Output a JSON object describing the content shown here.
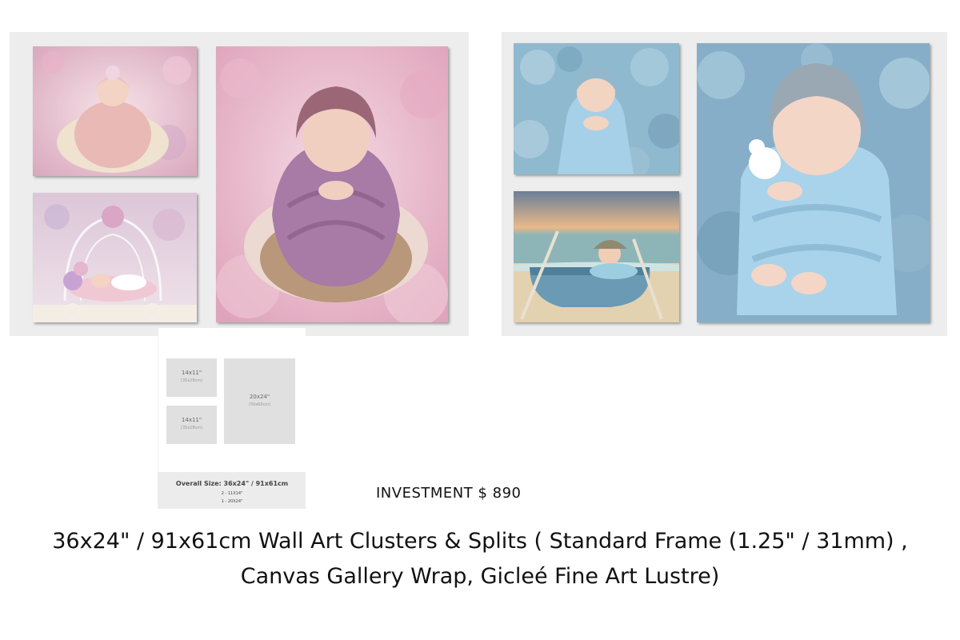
{
  "diagram": {
    "boxes": [
      {
        "size": "14x11\"",
        "cm": "(35x28cm)"
      },
      {
        "size": "14x11\"",
        "cm": "(35x28cm)"
      },
      {
        "size": "20x24\"",
        "cm": "(50x60cm)"
      }
    ],
    "overall_size": "Overall Size: 36x24\" / 91x61cm",
    "line_2": "2 - 11X14\"",
    "line_3": "1 - 20X24\""
  },
  "investment": "INVESTMENT $ 890",
  "caption": "36x24\" / 91x61cm Wall Art Clusters & Splits ( Standard Frame (1.25\" / 31mm) , Canvas Gallery Wrap, Gicleé Fine Art Lustre)",
  "colors": {
    "pink_theme": "#e8c3d1",
    "blue_theme": "#9cc3d8",
    "panel_bg": "#ededed",
    "beach_sky": "#e9b989"
  }
}
